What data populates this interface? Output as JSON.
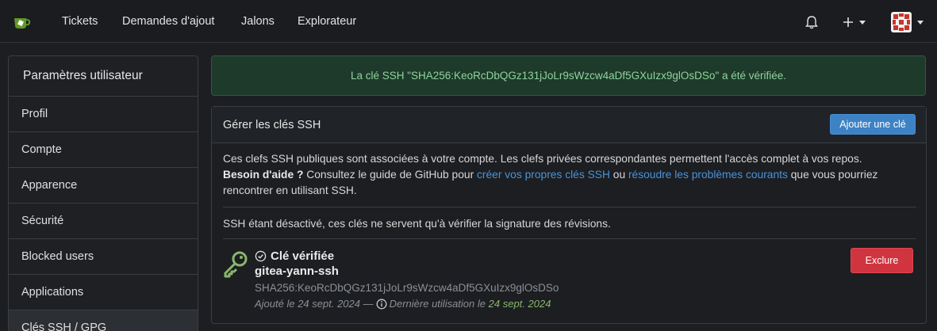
{
  "nav": {
    "items": [
      {
        "label": "Tickets"
      },
      {
        "label": "Demandes d'ajout"
      },
      {
        "label": "Jalons"
      },
      {
        "label": "Explorateur"
      }
    ]
  },
  "sidebar": {
    "title": "Paramètres utilisateur",
    "items": [
      {
        "label": "Profil"
      },
      {
        "label": "Compte"
      },
      {
        "label": "Apparence"
      },
      {
        "label": "Sécurité"
      },
      {
        "label": "Blocked users"
      },
      {
        "label": "Applications"
      },
      {
        "label": "Clés SSH / GPG"
      }
    ],
    "active_item": "Clés SSH / GPG"
  },
  "flash": {
    "message": "La clé SSH \"SHA256:KeoRcDbQGz131jJoLr9sWzcw4aDf5GXuIzx9glOsDSo\" a été vérifiée."
  },
  "panel": {
    "title": "Gérer les clés SSH",
    "add_button": "Ajouter une clé",
    "description_line1": "Ces clefs SSH publiques sont associées à votre compte. Les clefs privées correspondantes permettent l'accès complet à vos repos.",
    "help_bold": "Besoin d'aide ?",
    "help_text1": " Consultez le guide de GitHub pour ",
    "help_link1": "créer vos propres clés SSH",
    "help_text2": " ou ",
    "help_link2": "résoudre les problèmes courants",
    "help_text3": " que vous pourriez",
    "help_line3": "rencontrer en utilisant SSH.",
    "ssh_disabled_note": "SSH étant désactivé, ces clés ne servent qu'à vérifier la signature des révisions."
  },
  "key": {
    "verified_label": "Clé vérifiée",
    "name": "gitea-yann-ssh",
    "fingerprint": "SHA256:KeoRcDbQGz131jJoLr9sWzcw4aDf5GXuIzx9glOsDSo",
    "added_prefix": "Ajouté le 24 sept. 2024 —",
    "last_used_prefix": "Dernière utilisation le",
    "last_used_date": "24 sept. 2024",
    "delete_button": "Exclure"
  },
  "colors": {
    "accent": "#3d82c4",
    "danger": "#d0353f",
    "success_text": "#8fd39f",
    "key_icon": "#8ab56a"
  },
  "icons": {
    "logo": "gitea-logo",
    "notifications": "bell-icon",
    "create": "plus-icon",
    "avatar": "avatar",
    "key": "key-icon",
    "verified": "check-circle-icon",
    "info": "info-icon"
  }
}
